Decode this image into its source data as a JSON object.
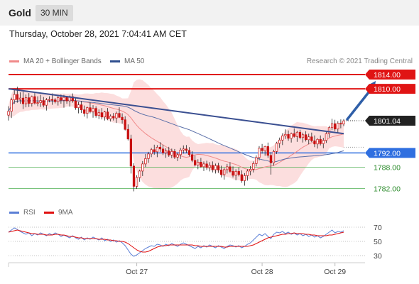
{
  "header": {
    "symbol": "Gold",
    "timeframe": "30 MIN",
    "datetime": "Thursday, October 28, 2021 7:04:41 AM CET"
  },
  "legend": {
    "items": [
      {
        "label": "MA 20 + Bollinger Bands",
        "color": "#f08a8a"
      },
      {
        "label": "MA 50",
        "color": "#2f4f8f"
      }
    ],
    "copyright": "Research © 2021 Trading Central"
  },
  "rsi_legend": {
    "items": [
      {
        "label": "RSI",
        "color": "#5b7fd6"
      },
      {
        "label": "9MA",
        "color": "#e01010"
      }
    ]
  },
  "price_labels": [
    {
      "value": "1814.00",
      "style": "box",
      "color": "#e01414"
    },
    {
      "value": "1810.00",
      "style": "box",
      "color": "#e01414"
    },
    {
      "value": "1801.04",
      "style": "box",
      "color": "#222222"
    },
    {
      "value": "1792.00",
      "style": "box",
      "color": "#2f6fe0"
    },
    {
      "value": "1788.00",
      "style": "text",
      "color": "#2a8a2a"
    },
    {
      "value": "1782.00",
      "style": "text",
      "color": "#2a8a2a"
    }
  ],
  "rsi_ticks": [
    "70",
    "50",
    "30"
  ],
  "x_labels": [
    "Oct 27",
    "Oct 28",
    "Oct 29"
  ],
  "chart_data": [
    {
      "type": "candlestick",
      "title": "Gold 30 MIN",
      "ylim": [
        1779.5,
        1816.0
      ],
      "levels": {
        "resistance": [
          1814.0,
          1810.0
        ],
        "current": 1801.04,
        "support": [
          1792.0,
          1788.0,
          1782.0
        ]
      },
      "trendline": {
        "start": [
          0,
          1810.0
        ],
        "end": [
          115,
          1797.4
        ]
      },
      "projection": {
        "start": [
          116,
          1801.2
        ],
        "end": [
          126,
          1812.2
        ]
      },
      "candles": [
        [
          1802.6,
          1805.1,
          1801.1,
          1803.7
        ],
        [
          1803.7,
          1807.5,
          1801.8,
          1806.9
        ],
        [
          1806.9,
          1809.7,
          1805.8,
          1808.4
        ],
        [
          1808.4,
          1810.6,
          1806.1,
          1807.0
        ],
        [
          1807.0,
          1809.0,
          1805.8,
          1807.4
        ],
        [
          1807.4,
          1809.2,
          1804.3,
          1805.8
        ],
        [
          1805.8,
          1808.4,
          1804.8,
          1807.5
        ],
        [
          1807.5,
          1808.8,
          1804.9,
          1805.9
        ],
        [
          1805.9,
          1808.1,
          1805.0,
          1807.8
        ],
        [
          1807.8,
          1808.8,
          1805.6,
          1806.0
        ],
        [
          1806.0,
          1807.9,
          1805.1,
          1806.1
        ],
        [
          1806.1,
          1808.3,
          1804.9,
          1806.7
        ],
        [
          1806.7,
          1807.7,
          1804.8,
          1805.4
        ],
        [
          1805.4,
          1807.4,
          1803.9,
          1806.9
        ],
        [
          1806.9,
          1807.9,
          1806.2,
          1807.0
        ],
        [
          1807.0,
          1808.7,
          1805.5,
          1806.9
        ],
        [
          1806.9,
          1807.4,
          1805.9,
          1806.4
        ],
        [
          1806.4,
          1808.2,
          1805.3,
          1807.5
        ],
        [
          1807.5,
          1808.4,
          1805.8,
          1806.8
        ],
        [
          1806.8,
          1808.3,
          1804.7,
          1807.6
        ],
        [
          1807.6,
          1808.0,
          1805.8,
          1806.6
        ],
        [
          1806.6,
          1808.1,
          1805.0,
          1807.8
        ],
        [
          1807.8,
          1808.7,
          1806.1,
          1806.6
        ],
        [
          1806.6,
          1807.4,
          1804.1,
          1804.7
        ],
        [
          1804.7,
          1806.3,
          1803.1,
          1805.5
        ],
        [
          1805.5,
          1806.6,
          1803.2,
          1804.1
        ],
        [
          1804.1,
          1805.3,
          1802.2,
          1803.1
        ],
        [
          1803.1,
          1805.0,
          1801.7,
          1804.7
        ],
        [
          1804.7,
          1806.2,
          1803.1,
          1803.6
        ],
        [
          1803.6,
          1805.4,
          1801.9,
          1804.5
        ],
        [
          1804.5,
          1805.1,
          1801.9,
          1802.5
        ],
        [
          1802.5,
          1804.2,
          1801.5,
          1803.3
        ],
        [
          1803.3,
          1804.6,
          1801.4,
          1802.1
        ],
        [
          1802.1,
          1803.8,
          1801.1,
          1803.5
        ],
        [
          1803.5,
          1804.6,
          1801.2,
          1801.6
        ],
        [
          1801.6,
          1802.8,
          1800.8,
          1802.3
        ],
        [
          1802.3,
          1803.2,
          1801.1,
          1801.8
        ],
        [
          1801.8,
          1803.6,
          1800.4,
          1803.1
        ],
        [
          1803.1,
          1804.8,
          1801.8,
          1802.0
        ],
        [
          1802.0,
          1803.1,
          1800.2,
          1801.3
        ],
        [
          1801.3,
          1802.3,
          1798.3,
          1798.6
        ],
        [
          1798.6,
          1800.0,
          1795.5,
          1795.9
        ],
        [
          1795.9,
          1797.1,
          1786.2,
          1788.3
        ],
        [
          1788.3,
          1789.1,
          1781.2,
          1782.6
        ],
        [
          1782.6,
          1785.7,
          1781.9,
          1785.1
        ],
        [
          1785.1,
          1787.3,
          1783.9,
          1786.9
        ],
        [
          1786.9,
          1789.7,
          1785.5,
          1788.9
        ],
        [
          1788.9,
          1791.7,
          1788.0,
          1790.4
        ],
        [
          1790.4,
          1792.3,
          1789.2,
          1791.7
        ],
        [
          1791.7,
          1793.4,
          1790.8,
          1792.9
        ],
        [
          1792.9,
          1794.3,
          1791.5,
          1792.3
        ],
        [
          1792.3,
          1794.2,
          1790.8,
          1793.6
        ],
        [
          1793.6,
          1795.0,
          1792.3,
          1793.1
        ],
        [
          1793.1,
          1794.3,
          1791.4,
          1792.0
        ],
        [
          1792.0,
          1793.3,
          1790.6,
          1792.6
        ],
        [
          1792.6,
          1793.7,
          1790.9,
          1791.4
        ],
        [
          1791.4,
          1793.2,
          1790.5,
          1792.4
        ],
        [
          1792.4,
          1793.1,
          1790.3,
          1790.8
        ],
        [
          1790.8,
          1792.1,
          1789.7,
          1791.5
        ],
        [
          1791.5,
          1793.4,
          1790.3,
          1792.8
        ],
        [
          1792.8,
          1794.1,
          1791.8,
          1793.1
        ],
        [
          1793.1,
          1794.2,
          1792.0,
          1792.7
        ],
        [
          1792.7,
          1793.6,
          1791.0,
          1791.5
        ],
        [
          1791.5,
          1792.5,
          1789.4,
          1789.9
        ],
        [
          1789.9,
          1791.3,
          1788.2,
          1788.6
        ],
        [
          1788.6,
          1790.2,
          1787.4,
          1789.4
        ],
        [
          1789.4,
          1790.6,
          1787.8,
          1788.1
        ],
        [
          1788.1,
          1789.6,
          1786.9,
          1788.9
        ],
        [
          1788.9,
          1789.8,
          1787.2,
          1787.9
        ],
        [
          1787.9,
          1789.4,
          1786.8,
          1788.5
        ],
        [
          1788.5,
          1789.6,
          1786.5,
          1787.3
        ],
        [
          1787.3,
          1789.0,
          1786.2,
          1788.4
        ],
        [
          1788.4,
          1789.2,
          1786.4,
          1787.2
        ],
        [
          1787.2,
          1788.4,
          1785.1,
          1785.9
        ],
        [
          1785.9,
          1787.8,
          1784.5,
          1787.3
        ],
        [
          1787.3,
          1788.9,
          1786.2,
          1788.1
        ],
        [
          1788.1,
          1789.4,
          1786.4,
          1786.8
        ],
        [
          1786.8,
          1788.2,
          1785.1,
          1785.7
        ],
        [
          1785.7,
          1787.4,
          1784.3,
          1786.8
        ],
        [
          1786.8,
          1787.9,
          1785.4,
          1785.9
        ],
        [
          1785.9,
          1787.1,
          1783.6,
          1784.2
        ],
        [
          1784.2,
          1786.3,
          1782.8,
          1785.6
        ],
        [
          1785.6,
          1787.4,
          1784.2,
          1786.9
        ],
        [
          1786.9,
          1788.3,
          1785.7,
          1787.4
        ],
        [
          1787.4,
          1789.6,
          1786.5,
          1789.0
        ],
        [
          1789.0,
          1791.3,
          1788.2,
          1790.7
        ],
        [
          1790.7,
          1793.9,
          1789.9,
          1793.3
        ],
        [
          1793.3,
          1794.5,
          1791.8,
          1792.6
        ],
        [
          1792.6,
          1794.0,
          1791.2,
          1793.8
        ],
        [
          1793.8,
          1794.9,
          1790.6,
          1791.3
        ],
        [
          1791.3,
          1792.2,
          1785.9,
          1789.2
        ],
        [
          1789.2,
          1792.9,
          1788.4,
          1792.4
        ],
        [
          1792.4,
          1795.1,
          1791.7,
          1794.7
        ],
        [
          1794.7,
          1796.3,
          1793.4,
          1795.6
        ],
        [
          1795.6,
          1797.5,
          1794.2,
          1796.8
        ],
        [
          1796.8,
          1798.6,
          1795.9,
          1797.2
        ],
        [
          1797.2,
          1798.3,
          1795.4,
          1796.1
        ],
        [
          1796.1,
          1797.7,
          1794.9,
          1797.4
        ],
        [
          1797.4,
          1798.9,
          1796.3,
          1796.6
        ],
        [
          1796.6,
          1798.2,
          1795.1,
          1797.8
        ],
        [
          1797.8,
          1798.5,
          1795.8,
          1796.3
        ],
        [
          1796.3,
          1797.7,
          1794.9,
          1797.1
        ],
        [
          1797.1,
          1798.1,
          1795.2,
          1795.7
        ],
        [
          1795.7,
          1797.4,
          1794.4,
          1796.5
        ],
        [
          1796.5,
          1797.7,
          1795.0,
          1795.4
        ],
        [
          1795.4,
          1796.9,
          1793.6,
          1794.5
        ],
        [
          1794.5,
          1796.1,
          1793.2,
          1795.8
        ],
        [
          1795.8,
          1796.9,
          1794.1,
          1794.6
        ],
        [
          1794.6,
          1796.2,
          1793.3,
          1795.5
        ],
        [
          1795.5,
          1797.9,
          1794.8,
          1797.4
        ],
        [
          1797.4,
          1799.6,
          1796.3,
          1799.1
        ],
        [
          1799.1,
          1801.6,
          1798.4,
          1800.2
        ],
        [
          1800.2,
          1801.3,
          1798.1,
          1798.7
        ],
        [
          1798.7,
          1800.9,
          1797.6,
          1800.3
        ],
        [
          1800.3,
          1801.4,
          1798.9,
          1800.1
        ],
        [
          1800.1,
          1801.5,
          1799.5,
          1801.0
        ]
      ]
    },
    {
      "type": "line",
      "title": "RSI",
      "ylim": [
        20,
        80
      ],
      "ticks": [
        70,
        50,
        30
      ],
      "series": [
        {
          "name": "RSI",
          "color": "#5b7fd6",
          "values": [
            63,
            66,
            69,
            67,
            64,
            62,
            60,
            62,
            58,
            61,
            59,
            62,
            60,
            58,
            61,
            59,
            62,
            60,
            57,
            59,
            57,
            55,
            58,
            55,
            53,
            56,
            52,
            55,
            53,
            56,
            54,
            52,
            55,
            51,
            53,
            50,
            52,
            49,
            51,
            48,
            44,
            38,
            32,
            29,
            31,
            34,
            37,
            40,
            42,
            44,
            43,
            46,
            45,
            43,
            46,
            44,
            47,
            45,
            43,
            46,
            48,
            46,
            44,
            42,
            40,
            43,
            41,
            44,
            42,
            45,
            43,
            41,
            44,
            42,
            40,
            43,
            45,
            44,
            42,
            44,
            41,
            43,
            46,
            48,
            52,
            56,
            60,
            58,
            61,
            57,
            54,
            60,
            63,
            62,
            64,
            61,
            63,
            60,
            62,
            59,
            61,
            58,
            60,
            57,
            59,
            56,
            58,
            55,
            57,
            60,
            63,
            66,
            62,
            64,
            63,
            65
          ]
        },
        {
          "name": "9MA",
          "color": "#e01010",
          "values": [
            63,
            64,
            65,
            66,
            65,
            64,
            63,
            62,
            61,
            61,
            60,
            60,
            60,
            59,
            59,
            59,
            60,
            60,
            59,
            59,
            58,
            57,
            57,
            56,
            55,
            55,
            54,
            54,
            54,
            54,
            54,
            53,
            53,
            53,
            52,
            52,
            51,
            51,
            50,
            50,
            49,
            47,
            44,
            41,
            38,
            36,
            35,
            35,
            36,
            38,
            40,
            42,
            43,
            44,
            44,
            45,
            45,
            45,
            45,
            45,
            45,
            45,
            45,
            45,
            44,
            44,
            43,
            43,
            43,
            43,
            43,
            43,
            43,
            43,
            42,
            42,
            43,
            43,
            43,
            43,
            43,
            43,
            43,
            44,
            45,
            47,
            49,
            51,
            53,
            55,
            56,
            57,
            58,
            59,
            60,
            60,
            61,
            61,
            62,
            61,
            61,
            61,
            60,
            60,
            59,
            59,
            58,
            58,
            58,
            58,
            59,
            59,
            60,
            61,
            62,
            63
          ]
        }
      ]
    }
  ]
}
